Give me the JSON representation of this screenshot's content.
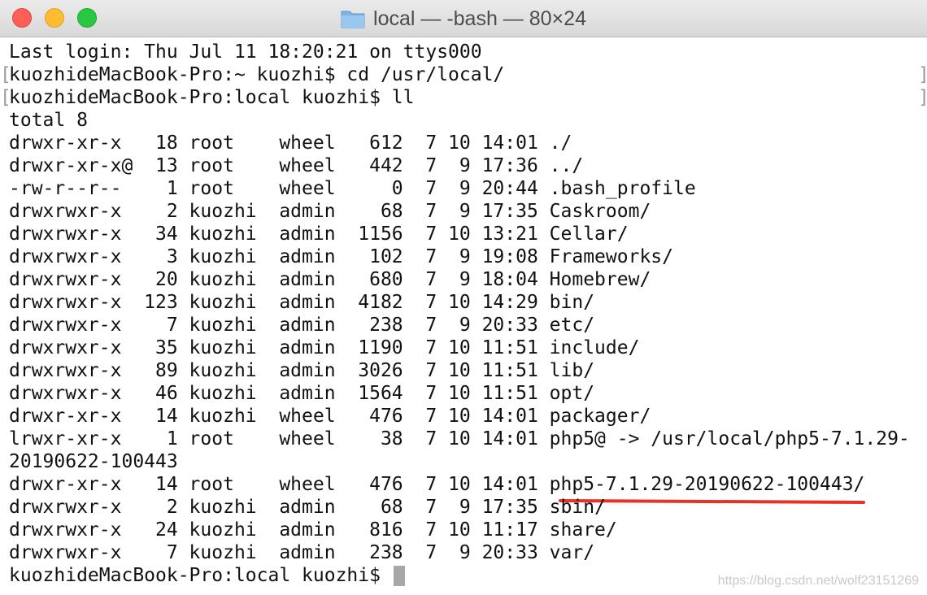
{
  "window": {
    "title": "local — -bash — 80×24",
    "folder_icon": "folder-icon",
    "title_color": "#4c4c4c"
  },
  "terminal": {
    "lines": [
      "Last login: Thu Jul 11 18:20:21 on ttys000",
      "kuozhideMacBook-Pro:~ kuozhi$ cd /usr/local/",
      "kuozhideMacBook-Pro:local kuozhi$ ll",
      "total 8",
      "drwxr-xr-x   18 root    wheel   612  7 10 14:01 ./",
      "drwxr-xr-x@  13 root    wheel   442  7  9 17:36 ../",
      "-rw-r--r--    1 root    wheel     0  7  9 20:44 .bash_profile",
      "drwxrwxr-x    2 kuozhi  admin    68  7  9 17:35 Caskroom/",
      "drwxrwxr-x   34 kuozhi  admin  1156  7 10 13:21 Cellar/",
      "drwxrwxr-x    3 kuozhi  admin   102  7  9 19:08 Frameworks/",
      "drwxrwxr-x   20 kuozhi  admin   680  7  9 18:04 Homebrew/",
      "drwxrwxr-x  123 kuozhi  admin  4182  7 10 14:29 bin/",
      "drwxrwxr-x    7 kuozhi  admin   238  7  9 20:33 etc/",
      "drwxrwxr-x   35 kuozhi  admin  1190  7 10 11:51 include/",
      "drwxrwxr-x   89 kuozhi  admin  3026  7 10 11:51 lib/",
      "drwxrwxr-x   46 kuozhi  admin  1564  7 10 11:51 opt/",
      "drwxr-xr-x   14 kuozhi  wheel   476  7 10 14:01 packager/",
      "lrwxr-xr-x    1 root    wheel    38  7 10 14:01 php5@ -> /usr/local/php5-7.1.29-",
      "20190622-100443",
      "drwxr-xr-x   14 root    wheel   476  7 10 14:01 php5-7.1.29-20190622-100443/",
      "drwxrwxr-x    2 kuozhi  admin    68  7  9 17:35 sbin/",
      "drwxrwxr-x   24 kuozhi  admin   816  7 10 11:17 share/",
      "drwxrwxr-x    7 kuozhi  admin   238  7  9 20:33 var/"
    ],
    "prompt": "kuozhideMacBook-Pro:local kuozhi$ ",
    "highlight_color": "#e6332a"
  },
  "watermark": "https://blog.csdn.net/wolf23151269"
}
